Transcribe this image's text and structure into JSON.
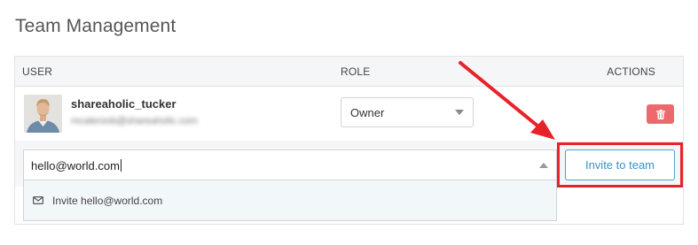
{
  "page": {
    "title": "Team Management"
  },
  "table": {
    "headers": {
      "user": "USER",
      "role": "ROLE",
      "actions": "ACTIONS"
    },
    "rows": [
      {
        "username": "shareaholic_tucker",
        "email": "mcaleroob@shareaholic.com",
        "role": "Owner"
      }
    ]
  },
  "invite": {
    "input_value": "hello@world.com",
    "suggestion": "Invite hello@world.com",
    "button_label": "Invite to team"
  },
  "annotation": {
    "color": "#e8222a"
  },
  "colors": {
    "danger": "#ec6a6e",
    "accent": "#3a92c8"
  }
}
